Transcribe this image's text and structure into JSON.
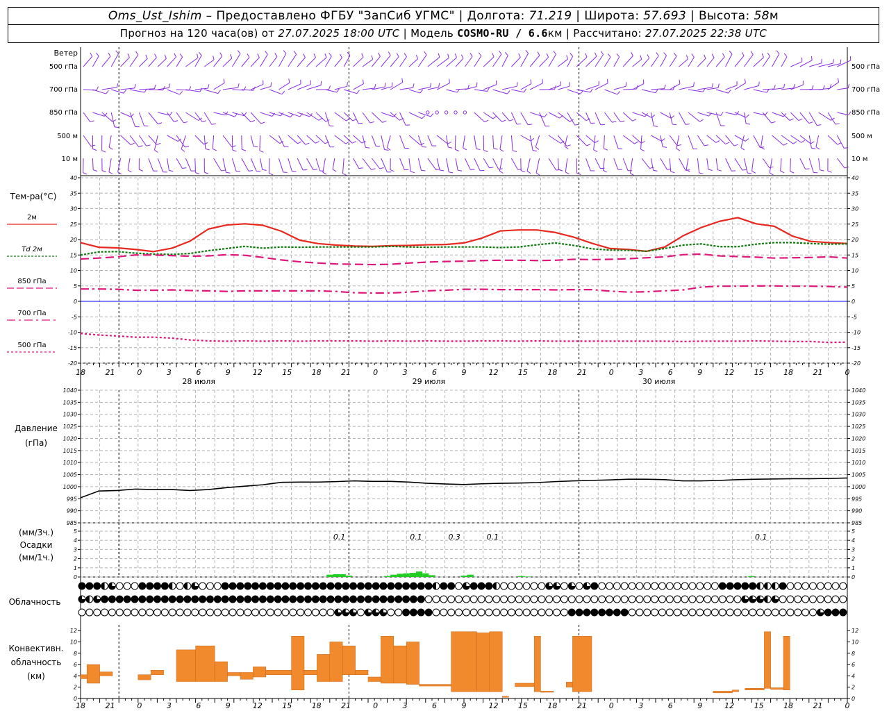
{
  "header": {
    "station": "Oms_Ust_Ishim",
    "provided_by": "– Предоставлено ФГБУ \"ЗапСиб УГМС\"",
    "sep": "|",
    "lon_label": "Долгота:",
    "lon_value": "71.219",
    "lat_label": "Широта:",
    "lat_value": "57.693",
    "alt_label": "Высота:",
    "alt_value": "58",
    "alt_unit": "м",
    "forecast_label": "Прогноз на 120 часа(ов) от",
    "forecast_from": "27.07.2025 18:00 UTC",
    "model_label": "| Модель",
    "model_name": "COSMO-RU / 6.6",
    "model_unit": "км",
    "computed_label": "| Рассчитано:",
    "computed_at": "27.07.2025 22:38 UTC"
  },
  "panels": {
    "wind": {
      "title": "Ветер",
      "levels": [
        "500 гПа",
        "700 гПа",
        "850 гПа",
        "500 м",
        "10 м"
      ]
    },
    "temperature": {
      "title": "Тем-ра(°C)",
      "legend": [
        "2м",
        "Td  2м",
        "850 гПа",
        "700 гПа",
        "500 гПа"
      ]
    },
    "pressure": {
      "title": "Давление",
      "unit": "(гПа)"
    },
    "precip": {
      "title": "Осадки",
      "unit_top": "(мм/3ч.)",
      "unit_bottom": "(мм/1ч.)"
    },
    "cloud": {
      "title": "Облачность"
    },
    "convective": {
      "title": "Конвективн.",
      "title2": "облачность",
      "unit": "(км)"
    }
  },
  "time_axis": {
    "hour_labels": [
      "18",
      "21",
      "0",
      "3",
      "6",
      "9",
      "12",
      "15",
      "18",
      "21",
      "0",
      "3",
      "6",
      "9",
      "12",
      "15",
      "18",
      "21",
      "0",
      "3",
      "6",
      "9",
      "12",
      "15",
      "18",
      "21",
      "0"
    ],
    "day_labels": [
      "28 июля",
      "29 июля",
      "30 июля"
    ]
  },
  "colors": {
    "wind": "#8a2be2",
    "t2m": "#e8281e",
    "td2m": "#0b7a0b",
    "t850": "#e0157a",
    "t500": "#e0157a",
    "precip": "#22cc22",
    "convective": "#f08a2c",
    "zero_line": "#0000ff",
    "grid": "#b4b4b4"
  },
  "chart_data": [
    {
      "type": "line",
      "title": "Тем-ра(°C)",
      "x_hours": [
        0,
        3,
        6,
        9,
        12,
        15,
        18,
        21,
        24,
        27,
        30,
        33,
        36,
        39,
        42,
        45,
        48,
        51,
        54,
        57,
        60,
        63,
        66,
        69,
        72,
        75,
        78,
        81,
        84,
        87,
        90,
        93,
        96,
        99,
        102,
        105,
        108,
        111,
        114,
        117,
        120,
        123,
        126
      ],
      "ylim": [
        -20,
        40
      ],
      "series": [
        {
          "name": "2м",
          "values": [
            19,
            17.5,
            17.3,
            16.8,
            16.1,
            17.2,
            19.5,
            23.4,
            24.7,
            25.1,
            24.6,
            22.7,
            19.8,
            18.7,
            18.2,
            17.9,
            17.8,
            18,
            18.1,
            18.3,
            18.4,
            18.9,
            20.5,
            22.8,
            23.1,
            23.1,
            22.3,
            20.8,
            18.8,
            17.1,
            16.8,
            16.2,
            17.6,
            21.2,
            23.9,
            25.9,
            27.1,
            25.1,
            24.3,
            21.1,
            19.4,
            19,
            18.7
          ]
        },
        {
          "name": "Td  2м",
          "values": [
            15,
            16,
            16.1,
            15.6,
            15.3,
            15.2,
            15.5,
            16.4,
            17.1,
            17.8,
            17.2,
            17.6,
            17.5,
            17.6,
            17.6,
            17.6,
            17.6,
            17.8,
            17.6,
            17.5,
            17.6,
            17.6,
            17.6,
            17.4,
            17.6,
            18.3,
            18.9,
            18.1,
            17,
            16.6,
            16.5,
            16.2,
            17.1,
            18.2,
            18.6,
            17.7,
            17.7,
            18.5,
            19,
            19,
            18.7,
            18.5,
            18.6
          ]
        },
        {
          "name": "850 гПа",
          "values": [
            13.7,
            14,
            14.4,
            15,
            15,
            14.8,
            14.6,
            14.7,
            15.1,
            14.9,
            14.2,
            13.4,
            12.8,
            12.4,
            12.1,
            12,
            11.9,
            12,
            12.4,
            12.7,
            12.9,
            13,
            13.2,
            13.3,
            13.3,
            13.2,
            13.3,
            13.6,
            13.5,
            13.6,
            13.8,
            14.1,
            14.4,
            15.1,
            15.3,
            14.7,
            14.5,
            14.3,
            14,
            14.1,
            14.2,
            14.4,
            14
          ]
        },
        {
          "name": "700 гПа",
          "values": [
            4,
            4,
            3.9,
            3.6,
            3.6,
            3.7,
            3.5,
            3.4,
            3.2,
            3.4,
            3.4,
            3.4,
            3.4,
            3.4,
            3.2,
            2.8,
            2.7,
            2.7,
            3,
            3.4,
            3.6,
            3.9,
            3.9,
            3.8,
            3.8,
            3.8,
            3.7,
            3.8,
            3.8,
            3.3,
            3,
            3.1,
            3.4,
            3.7,
            4.6,
            4.9,
            4.9,
            5,
            5,
            4.9,
            4.9,
            4.8,
            4.6
          ]
        },
        {
          "name": "500 гПа",
          "values": [
            -10.4,
            -10.9,
            -11.2,
            -11.6,
            -11.6,
            -11.9,
            -12.5,
            -12.8,
            -12.9,
            -12.8,
            -12.9,
            -12.8,
            -12.9,
            -12.8,
            -12.8,
            -12.8,
            -12.9,
            -12.8,
            -12.9,
            -12.8,
            -12.9,
            -12.9,
            -12.8,
            -12.8,
            -12.9,
            -12.8,
            -12.9,
            -12.9,
            -12.9,
            -12.9,
            -12.9,
            -12.9,
            -12.9,
            -13,
            -12.9,
            -12.9,
            -12.9,
            -12.8,
            -12.9,
            -13,
            -13,
            -13.3,
            -13.2
          ]
        }
      ],
      "yticks": [
        -20,
        -15,
        -10,
        -5,
        0,
        5,
        10,
        15,
        20,
        25,
        30,
        35,
        40
      ]
    },
    {
      "type": "line",
      "title": "Давление",
      "ylabel": "(гПа)",
      "x_hours": [
        0,
        3,
        6,
        9,
        12,
        15,
        18,
        21,
        24,
        27,
        30,
        33,
        36,
        39,
        42,
        45,
        48,
        51,
        54,
        57,
        60,
        63,
        66,
        69,
        72,
        75,
        78,
        81,
        84,
        87,
        90,
        93,
        96,
        99,
        102,
        105,
        108,
        111,
        114,
        117,
        120,
        123,
        126
      ],
      "ylim": [
        985,
        1040
      ],
      "yticks": [
        985,
        990,
        995,
        1000,
        1005,
        1010,
        1015,
        1020,
        1025,
        1030,
        1035,
        1040
      ],
      "series": [
        {
          "name": "",
          "values": [
            995.4,
            998.2,
            998.4,
            999,
            998.8,
            998.8,
            998.4,
            998.8,
            999.6,
            1000.2,
            1000.8,
            1001.8,
            1001.9,
            1001.9,
            1002.1,
            1002.4,
            1002.2,
            1002.2,
            1001.9,
            1001.4,
            1001.1,
            1000.9,
            1001.2,
            1001.4,
            1001.5,
            1001.7,
            1002.1,
            1002.4,
            1002.6,
            1002.8,
            1003.1,
            1003.1,
            1002.9,
            1002.4,
            1002.4,
            1002.6,
            1002.9,
            1003.1,
            1003.2,
            1003.3,
            1003.3,
            1003.4,
            1003.6
          ]
        }
      ]
    },
    {
      "type": "bar",
      "title": "Осадки",
      "ylabel": "(мм/3ч.) / (мм/1ч.)",
      "ylim": [
        0,
        5
      ],
      "yticks": [
        0,
        1,
        2,
        3,
        4,
        5
      ],
      "bars_hours": [
        39,
        40,
        41,
        42,
        48,
        49,
        50,
        51,
        52,
        53,
        54,
        55,
        60,
        61,
        69,
        70,
        105
      ],
      "bars_values": [
        0.25,
        0.3,
        0.3,
        0.15,
        0.1,
        0.25,
        0.35,
        0.4,
        0.45,
        0.6,
        0.4,
        0.2,
        0.15,
        0.25,
        0.1,
        0.05,
        0.1
      ],
      "annotations": [
        {
          "hour": 40.5,
          "text": "0.1"
        },
        {
          "hour": 52.5,
          "text": "0.1"
        },
        {
          "hour": 58.5,
          "text": "0.3"
        },
        {
          "hour": 64.5,
          "text": "0.1"
        },
        {
          "hour": 106.5,
          "text": "0.1"
        }
      ]
    },
    {
      "type": "bar",
      "title": "Конвективн. облачность",
      "ylabel": "(км)",
      "ylim": [
        0,
        13
      ],
      "yticks": [
        0,
        2,
        4,
        6,
        8,
        10,
        12
      ],
      "bars": [
        {
          "h0": 0,
          "h1": 1,
          "bottom": 3.5,
          "top": 4.2
        },
        {
          "h0": 1,
          "h1": 3,
          "bottom": 2.7,
          "top": 6
        },
        {
          "h0": 3,
          "h1": 5,
          "bottom": 4,
          "top": 4.7
        },
        {
          "h0": 9,
          "h1": 11,
          "bottom": 3.3,
          "top": 4.2
        },
        {
          "h0": 11,
          "h1": 13,
          "bottom": 4.2,
          "top": 5
        },
        {
          "h0": 15,
          "h1": 18,
          "bottom": 3,
          "top": 8.6
        },
        {
          "h0": 18,
          "h1": 21,
          "bottom": 3,
          "top": 9.3
        },
        {
          "h0": 21,
          "h1": 23,
          "bottom": 3,
          "top": 6.5
        },
        {
          "h0": 23,
          "h1": 25,
          "bottom": 4,
          "top": 4.6
        },
        {
          "h0": 25,
          "h1": 27,
          "bottom": 3.4,
          "top": 4.6
        },
        {
          "h0": 27,
          "h1": 29,
          "bottom": 3.8,
          "top": 5.6
        },
        {
          "h0": 29,
          "h1": 33,
          "bottom": 4.2,
          "top": 5
        },
        {
          "h0": 33,
          "h1": 35,
          "bottom": 1.5,
          "top": 11
        },
        {
          "h0": 35,
          "h1": 37,
          "bottom": 4.2,
          "top": 5
        },
        {
          "h0": 37,
          "h1": 39,
          "bottom": 3,
          "top": 7.8
        },
        {
          "h0": 39,
          "h1": 41,
          "bottom": 3,
          "top": 10
        },
        {
          "h0": 41,
          "h1": 43,
          "bottom": 4.2,
          "top": 9.3
        },
        {
          "h0": 43,
          "h1": 45,
          "bottom": 4.2,
          "top": 5
        },
        {
          "h0": 45,
          "h1": 47,
          "bottom": 3,
          "top": 3.8
        },
        {
          "h0": 47,
          "h1": 49,
          "bottom": 2.7,
          "top": 11
        },
        {
          "h0": 49,
          "h1": 51,
          "bottom": 2.7,
          "top": 9.3
        },
        {
          "h0": 51,
          "h1": 53,
          "bottom": 2.5,
          "top": 10
        },
        {
          "h0": 53,
          "h1": 58,
          "bottom": 2.2,
          "top": 2.5
        },
        {
          "h0": 58,
          "h1": 62,
          "bottom": 1.2,
          "top": 11.8
        },
        {
          "h0": 62,
          "h1": 64,
          "bottom": 1.2,
          "top": 11.6
        },
        {
          "h0": 64,
          "h1": 66,
          "bottom": 1.2,
          "top": 11.8
        },
        {
          "h0": 66,
          "h1": 67,
          "bottom": 0.2,
          "top": 0.4
        },
        {
          "h0": 68,
          "h1": 71,
          "bottom": 2.1,
          "top": 2.7
        },
        {
          "h0": 71,
          "h1": 72,
          "bottom": 1.2,
          "top": 11
        },
        {
          "h0": 72,
          "h1": 74,
          "bottom": 1.1,
          "top": 1.3
        },
        {
          "h0": 76,
          "h1": 77,
          "bottom": 2,
          "top": 2.9
        },
        {
          "h0": 77,
          "h1": 80,
          "bottom": 1.2,
          "top": 11
        },
        {
          "h0": 99,
          "h1": 102,
          "bottom": 1,
          "top": 1.3
        },
        {
          "h0": 102,
          "h1": 103,
          "bottom": 1.2,
          "top": 1.5
        },
        {
          "h0": 104,
          "h1": 107,
          "bottom": 1.5,
          "top": 1.8
        },
        {
          "h0": 107,
          "h1": 108,
          "bottom": 1.8,
          "top": 11.8
        },
        {
          "h0": 108,
          "h1": 110,
          "bottom": 1.6,
          "top": 1.9
        },
        {
          "h0": 110,
          "h1": 111,
          "bottom": 1.5,
          "top": 11
        }
      ]
    }
  ],
  "cloud_rows": [
    "FFFHQ000FFFFH0HQ000FFFFFFFFFFFFFFFFFFFFFFFFFFFFHFF0QFFFH000000QQ0Q0QF0000000000000000FFFFFHHHF000000000",
    "QHQFFFFFFFFFFFFFFFFFFFFFFFFFFFFFFFFFFFFFFFFFFF000000000000000000000000000000000000000000QQQHQ00000000000",
    "0000000000000000000000000000000000QQQ0QQQ00FFFF000000000000000000FFFFFFFF0000000000000000000000000QFFFF"
  ]
}
